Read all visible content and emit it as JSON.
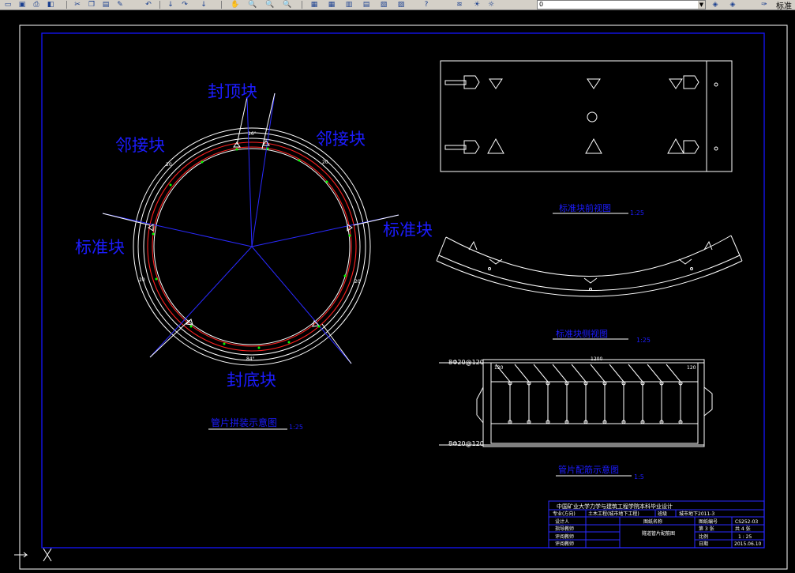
{
  "toolbar": {
    "layer_value": "0",
    "right_text": "标准"
  },
  "ring": {
    "labels": [
      "封顶块",
      "邻接块",
      "邻接块",
      "标准块",
      "标准块",
      "封底块"
    ],
    "caption": "管片拼装示意图",
    "scale": "1:25"
  },
  "front_view": {
    "caption": "标准块前视图",
    "scale": "1:25"
  },
  "side_view": {
    "caption": "标准块侧视图",
    "scale": "1:25"
  },
  "rebar": {
    "caption": "管片配筋示意图",
    "scale": "1:5",
    "top_label": "8Φ20@120",
    "bottom_label": "8Φ20@120",
    "dim_total": "1200",
    "dim_left": "120",
    "dim_right": "120"
  },
  "title_block": {
    "header": "中国矿业大学力学与建筑工程学院本科毕业设计",
    "r1": [
      "专业(方向)",
      "土木工程(城市地下工程)",
      "班级",
      "城市地下2011-3"
    ],
    "r2": [
      "设计人",
      "图纸名称",
      "图纸编号",
      "CS252-03"
    ],
    "r3": [
      "指导教师",
      "隧道管片配筋图",
      "第 3 张",
      "共 4 张"
    ],
    "r4": [
      "评阅教师",
      "比例",
      "1 : 25"
    ],
    "r5": [
      "评阅教师",
      "日期",
      "2015.06.10"
    ]
  },
  "colors": {
    "frame_blue": "#0000ff",
    "text_blue": "#1c1cff",
    "ring_red": "#ff2020",
    "green": "#00ff00",
    "white": "#ffffff"
  }
}
